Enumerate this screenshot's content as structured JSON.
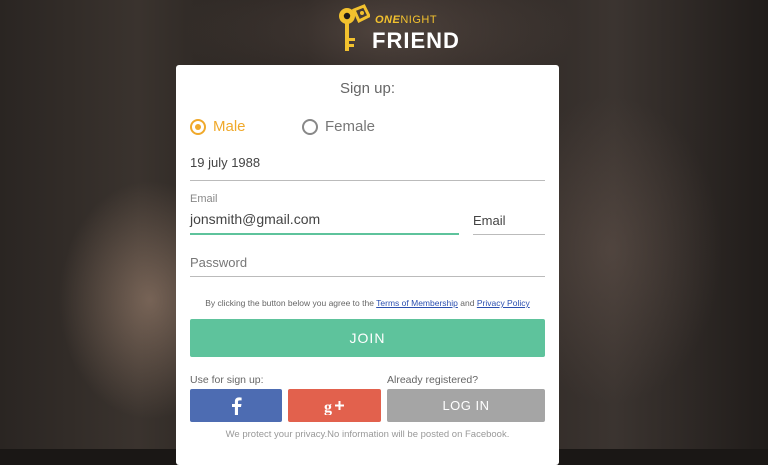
{
  "brand": {
    "top_one": "ONE",
    "top_night": "NIGHT",
    "bottom": "FRIEND"
  },
  "form": {
    "title": "Sign up:",
    "gender": {
      "options": [
        "Male",
        "Female"
      ],
      "selected": "Male"
    },
    "birthdate": "19 july 1988",
    "email_label": "Email",
    "email_value": "jonsmith@gmail.com",
    "email_type": "Email",
    "password_placeholder": "Password",
    "terms": {
      "prefix": "By clicking the button below you agree to the",
      "link1": "Terms of Membership",
      "and": "and",
      "link2": "Privacy Policy"
    },
    "join_label": "JOIN",
    "use_for_signup": "Use for sign up:",
    "already_registered": "Already registered?",
    "login_label": "LOG IN",
    "privacy_note": "We protect your privacy.No information will be posted on Facebook."
  },
  "colors": {
    "accent": "#f0a92b",
    "join": "#5ec39c",
    "facebook": "#4d6cb2",
    "google_plus": "#e2614d",
    "login": "#a5a5a5"
  },
  "icons": {
    "logo": "key-icon",
    "facebook": "facebook-icon",
    "google_plus": "google-plus-icon"
  }
}
